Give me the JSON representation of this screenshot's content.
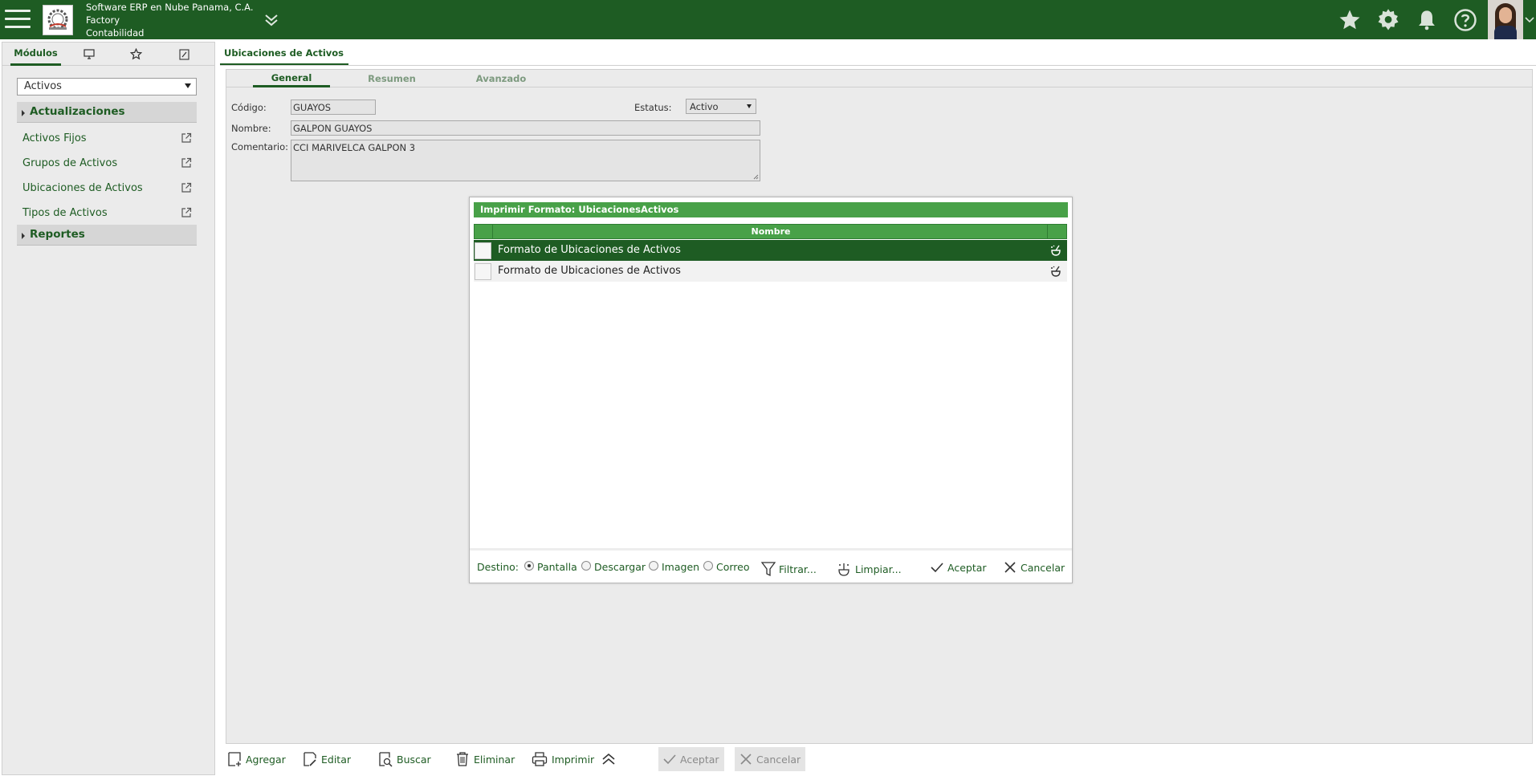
{
  "header": {
    "company": "Software ERP en Nube Panama, C.A.",
    "branch": "Factory",
    "module": "Contabilidad",
    "colors": {
      "brand": "#1e5c23",
      "accent": "#48a148"
    }
  },
  "sidebar": {
    "tabs": [
      {
        "label": "Módulos",
        "icon": ""
      },
      {
        "label": "",
        "icon": "monitor-icon"
      },
      {
        "label": "",
        "icon": "star-icon"
      },
      {
        "label": "",
        "icon": "edit-icon"
      }
    ],
    "module_select": "Activos",
    "groups": [
      {
        "label": "Actualizaciones",
        "items": [
          "Activos Fijos",
          "Grupos de Activos",
          "Ubicaciones de Activos",
          "Tipos de Activos"
        ]
      },
      {
        "label": "Reportes",
        "items": []
      }
    ]
  },
  "main": {
    "tab_title": "Ubicaciones de Activos",
    "sub_tabs": [
      "General",
      "Resumen",
      "Avanzado"
    ],
    "form": {
      "codigo_label": "Código:",
      "codigo_value": "GUAYOS",
      "estatus_label": "Estatus:",
      "estatus_value": "Activo",
      "nombre_label": "Nombre:",
      "nombre_value": "GALPON GUAYOS",
      "comentario_label": "Comentario:",
      "comentario_value": "CCI MARIVELCA GALPON 3"
    }
  },
  "dialog": {
    "title": "Imprimir Formato: UbicacionesActivos",
    "column_header": "Nombre",
    "rows": [
      {
        "name": "Formato de Ubicaciones de Activos",
        "selected": true
      },
      {
        "name": "Formato de Ubicaciones de Activos",
        "selected": false
      }
    ],
    "footer": {
      "destino_label": "Destino:",
      "destinations": [
        "Pantalla",
        "Descargar",
        "Imagen",
        "Correo"
      ],
      "selected_destination": "Pantalla",
      "filter_label": "Filtrar...",
      "clear_label": "Limpiar...",
      "accept_label": "Aceptar",
      "cancel_label": "Cancelar"
    }
  },
  "toolbar": {
    "add": "Agregar",
    "edit": "Editar",
    "search": "Buscar",
    "delete": "Eliminar",
    "print": "Imprimir",
    "accept": "Aceptar",
    "cancel": "Cancelar"
  }
}
